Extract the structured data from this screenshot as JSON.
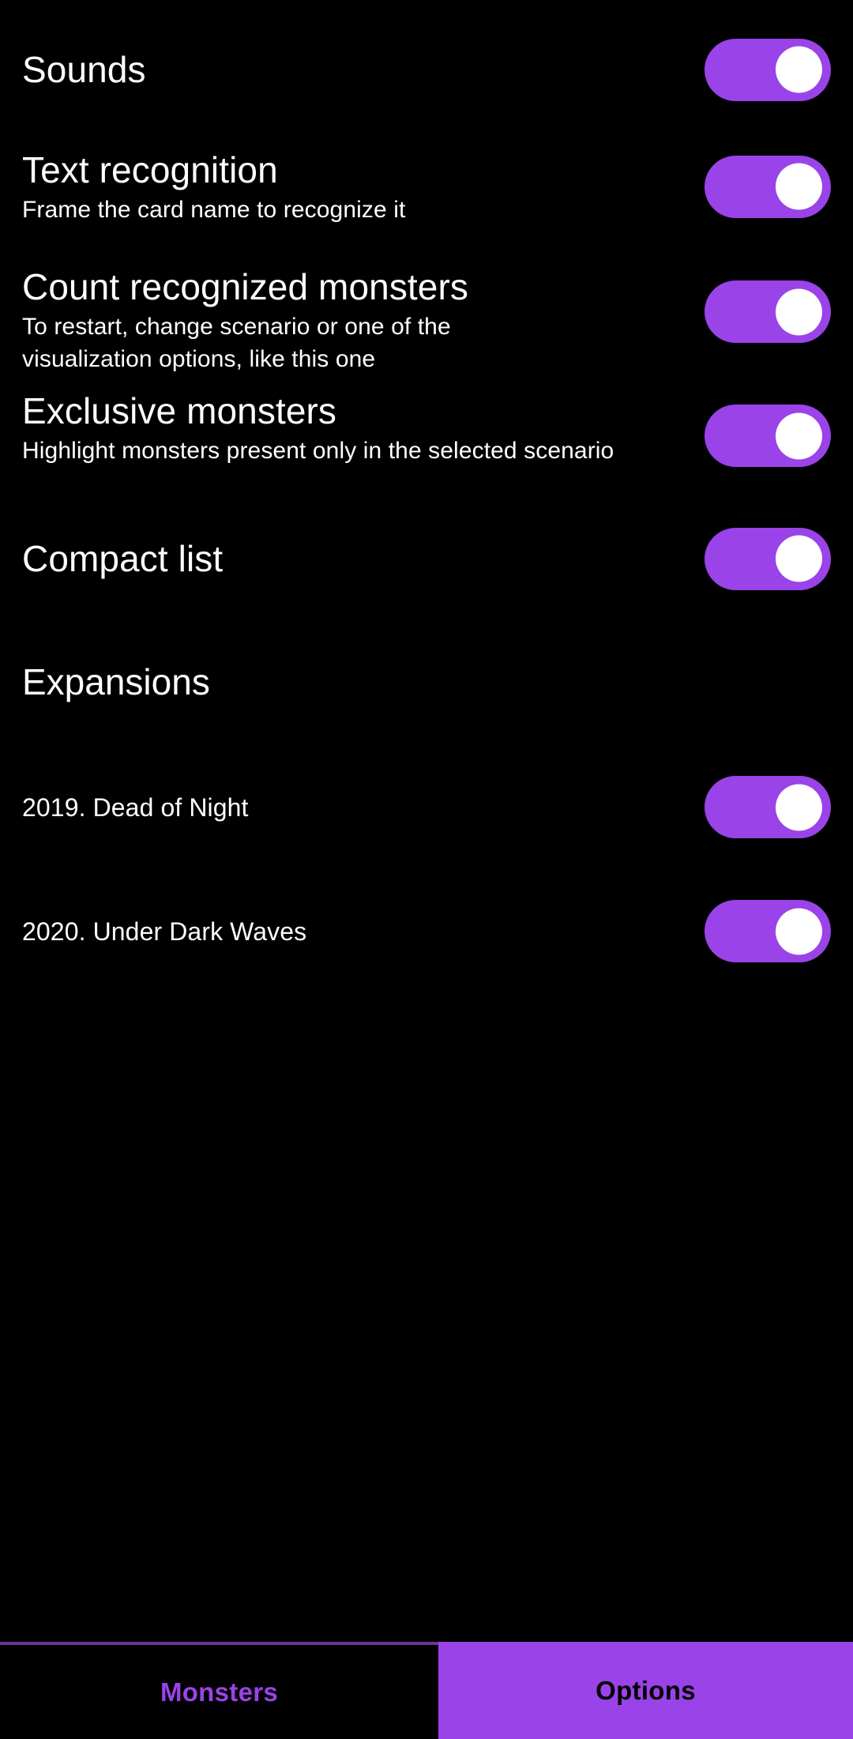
{
  "theme": {
    "background": "#000000",
    "accent": "#9a43e8",
    "text": "#ffffff",
    "tab_border": "#6b3596"
  },
  "settings": {
    "items": [
      {
        "title": "Sounds",
        "subtitle": "",
        "toggle": "on",
        "name": "sounds"
      },
      {
        "title": "Text recognition",
        "subtitle": "Frame the card name to recognize it",
        "toggle": "on",
        "name": "text-recognition"
      },
      {
        "title": "Count recognized monsters",
        "subtitle": "To restart, change scenario or one of the visualization options, like this one",
        "toggle": "on",
        "name": "count-recognized-monsters"
      },
      {
        "title": "Exclusive monsters",
        "subtitle": "Highlight monsters present only in the selected scenario",
        "toggle": "on",
        "name": "exclusive-monsters"
      },
      {
        "title": "Compact list",
        "subtitle": "",
        "toggle": "on",
        "name": "compact-list"
      }
    ]
  },
  "expansions": {
    "header": "Expansions",
    "items": [
      {
        "title": "2019. Dead of Night",
        "toggle": "on",
        "name": "dead-of-night"
      },
      {
        "title": "2020. Under Dark Waves",
        "toggle": "on",
        "name": "under-dark-waves"
      }
    ]
  },
  "tabbar": {
    "tabs": [
      {
        "label": "Monsters",
        "active": false
      },
      {
        "label": "Options",
        "active": true
      }
    ]
  }
}
